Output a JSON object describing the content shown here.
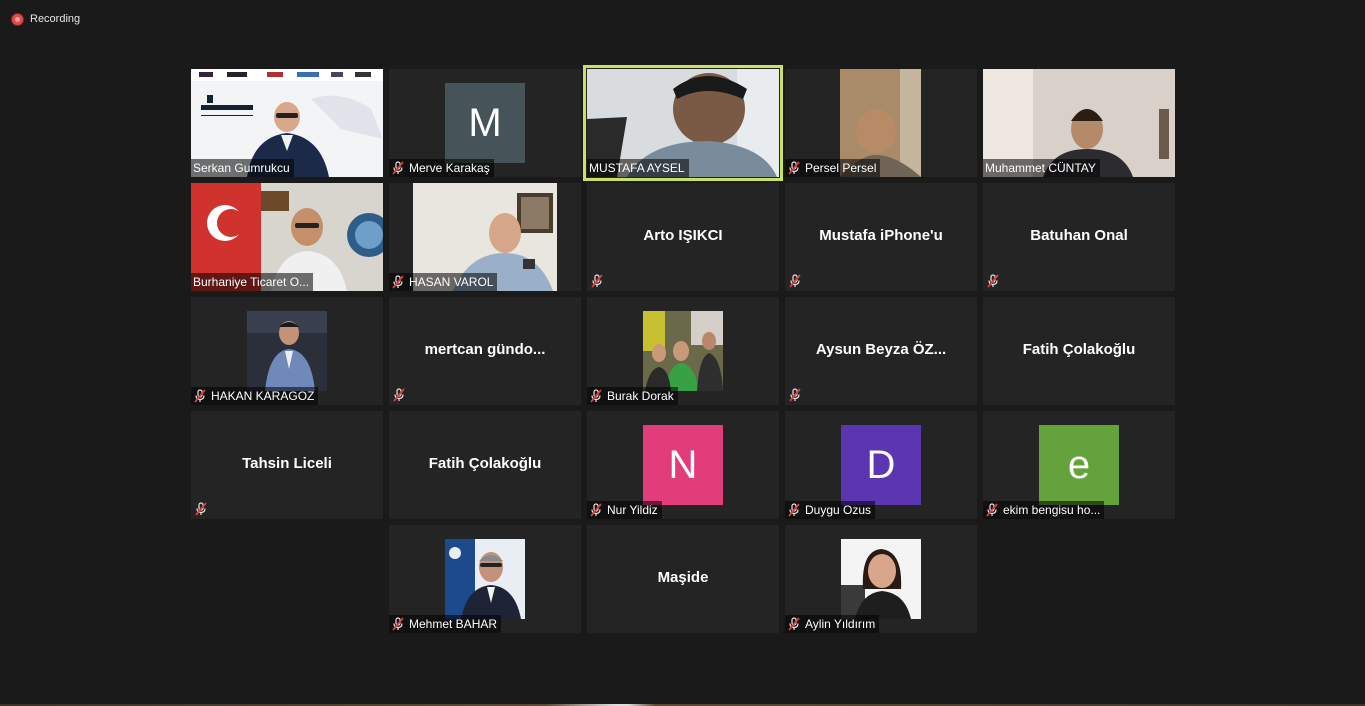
{
  "recording": {
    "label": "Recording"
  },
  "tiles": {
    "serkan": {
      "name": "Serkan Gumrukcu"
    },
    "merve": {
      "name": "Merve Karakaş",
      "initial": "M"
    },
    "mustafa_aysel": {
      "name": "MUSTAFA AYSEL"
    },
    "persel": {
      "name": "Persel Persel"
    },
    "muhammet": {
      "name": "Muhammet CÜNTAY"
    },
    "burhaniye": {
      "name": "Burhaniye Ticaret O..."
    },
    "hasan": {
      "name": "HASAN VAROL"
    },
    "arto": {
      "name": "Arto IŞIKCI"
    },
    "mustafa_iphone": {
      "name": "Mustafa iPhone'u"
    },
    "batuhan": {
      "name": "Batuhan Onal"
    },
    "hakan": {
      "name": "HAKAN KARAGOZ"
    },
    "mertcan": {
      "name": "mertcan  gündo..."
    },
    "burak": {
      "name": "Burak Dorak"
    },
    "aysun": {
      "name": "Aysun  Beyza  ÖZ..."
    },
    "fatih1": {
      "name": "Fatih Çolakoğlu"
    },
    "tahsin": {
      "name": "Tahsin Liceli"
    },
    "fatih2": {
      "name": "Fatih Çolakoğlu"
    },
    "nur": {
      "name": "Nur Yildiz",
      "initial": "N",
      "color": "#e23d7a"
    },
    "duygu": {
      "name": "Duygu Ozus",
      "initial": "D",
      "color": "#5c36b0"
    },
    "ekim": {
      "name": "ekim bengisu ho...",
      "initial": "e",
      "color": "#64a33b"
    },
    "mehmet": {
      "name": "Mehmet BAHAR"
    },
    "maside": {
      "name": "Maşide"
    },
    "aylin": {
      "name": "Aylin Yıldırım"
    }
  },
  "colors": {
    "speaking_outline": "#c9e265",
    "muted_icon": "#e03c3c",
    "merve_avatar": "#46545a"
  }
}
